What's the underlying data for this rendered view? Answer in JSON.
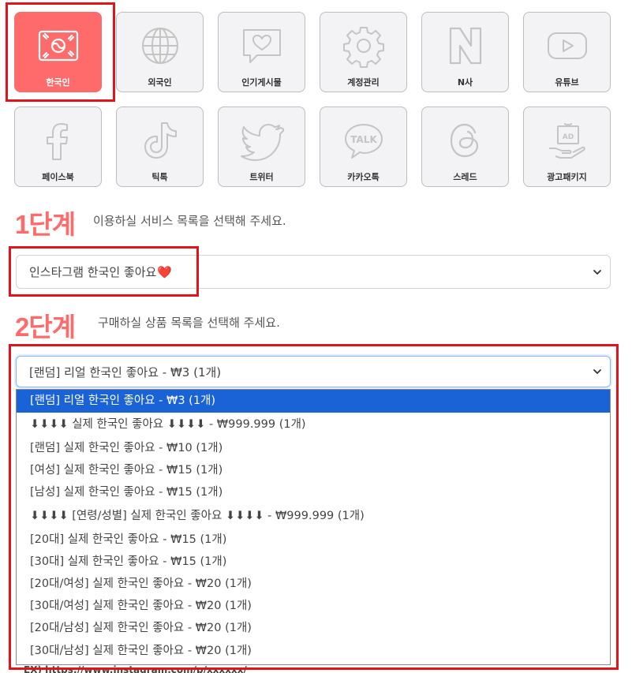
{
  "tiles": [
    {
      "label": "한국인",
      "icon": "korea-flag-icon"
    },
    {
      "label": "외국인",
      "icon": "globe-icon"
    },
    {
      "label": "인기게시물",
      "icon": "heart-chat-icon"
    },
    {
      "label": "계정관리",
      "icon": "gear-icon"
    },
    {
      "label": "N사",
      "icon": "naver-n-icon"
    },
    {
      "label": "유튜브",
      "icon": "youtube-icon"
    },
    {
      "label": "페이스북",
      "icon": "facebook-icon"
    },
    {
      "label": "틱톡",
      "icon": "tiktok-icon"
    },
    {
      "label": "트위터",
      "icon": "twitter-icon"
    },
    {
      "label": "카카오톡",
      "icon": "kakaotalk-icon"
    },
    {
      "label": "스레드",
      "icon": "threads-icon"
    },
    {
      "label": "광고패키지",
      "icon": "ad-gift-icon"
    }
  ],
  "step1": {
    "number": "1단계",
    "description": "이용하실 서비스 목록을 선택해 주세요.",
    "selected_service": "인스타그램 한국인 좋아요",
    "heart_emoji": "❤️"
  },
  "step2": {
    "number": "2단계",
    "description": "구매하실 상품 목록을 선택해 주세요.",
    "selected_product": "[랜덤] 리얼 한국인 좋아요 - ₩3 (1개)"
  },
  "product_options": [
    "[랜덤] 리얼 한국인 좋아요 - ₩3 (1개)",
    "⬇⬇⬇⬇ 실제 한국인 좋아요 ⬇⬇⬇⬇ - ₩999.999 (1개)",
    "[랜덤] 실제 한국인 좋아요 - ₩10 (1개)",
    "[여성] 실제 한국인 좋아요 - ₩15 (1개)",
    "[남성] 실제 한국인 좋아요 - ₩15 (1개)",
    "⬇⬇⬇⬇ [연령/성별] 실제 한국인 좋아요 ⬇⬇⬇⬇ - ₩999.999 (1개)",
    "[20대] 실제 한국인 좋아요 - ₩15 (1개)",
    "[30대] 실제 한국인 좋아요 - ₩15 (1개)",
    "[20대/여성] 실제 한국인 좋아요 - ₩20 (1개)",
    "[30대/여성] 실제 한국인 좋아요 - ₩20 (1개)",
    "[20대/남성] 실제 한국인 좋아요 - ₩20 (1개)",
    "[30대/남성] 실제 한국인 좋아요 - ₩20 (1개)"
  ],
  "below_text": "EX) https://www.instagram.com/p/xxxxxx/",
  "colors": {
    "accent": "#ff6b6b",
    "highlight_box": "#e0141b",
    "option_selected": "#1a63d6",
    "tile_bg": "#f3f3f5"
  }
}
